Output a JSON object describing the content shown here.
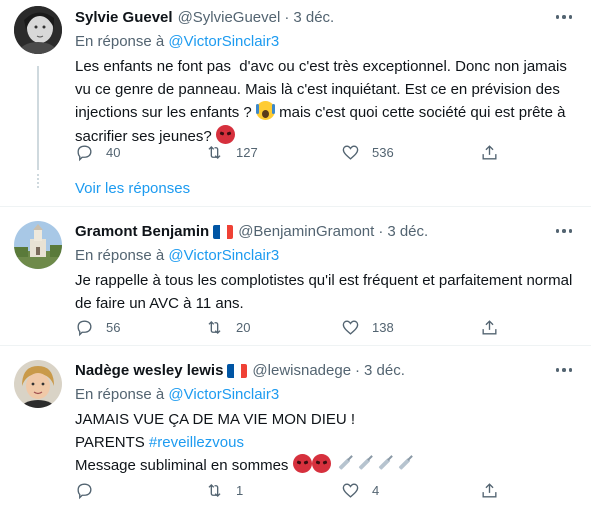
{
  "tweets": [
    {
      "name": "Sylvie Guevel",
      "handle": "@SylvieGuevel",
      "dot": "·",
      "date": "3 déc.",
      "reply_prefix": "En réponse à ",
      "reply_to": "@VictorSinclair3",
      "text_lines": [
        "Les enfants ne font pas  d'avc ou c'est très exceptionnel. Donc non jamais",
        "vu ce genre de panneau. Mais là c'est inquiétant. Est ce en prévision des",
        "injections sur les enfants ? ",
        " mais c'est quoi cette société qui est prête à",
        "sacrifier ses jeunes? "
      ],
      "replies": "40",
      "retweets": "127",
      "likes": "536",
      "avatar": "woman-portrait-grayscale"
    },
    {
      "name": "Gramont Benjamin",
      "handle": "@BenjaminGramont",
      "dot": "·",
      "date": "3 déc.",
      "flag": "france-flag",
      "reply_prefix": "En réponse à ",
      "reply_to": "@VictorSinclair3",
      "text_lines": [
        "Je rappelle à tous les complotistes qu'il est fréquent et parfaitement normal",
        "de faire un AVC à 11 ans."
      ],
      "replies": "56",
      "retweets": "20",
      "likes": "138",
      "avatar": "village-church-photo"
    },
    {
      "name": "Nadège wesley lewis",
      "handle": "@lewisnadege",
      "dot": "·",
      "date": "3 déc.",
      "flag": "france-flag",
      "reply_prefix": "En réponse à ",
      "reply_to": "@VictorSinclair3",
      "text_line1": "JAMAIS VUE ÇA DE MA VIE MON DIEU !",
      "text_line2_prefix": "PARENTS ",
      "hashtag": "#reveillezvous",
      "text_line3": "Message subliminal en sommes ",
      "replies": "",
      "retweets": "1",
      "likes": "4",
      "avatar": "woman-portrait-color"
    }
  ],
  "show_replies": "Voir les réponses",
  "colors": {
    "link": "#1d9bf0",
    "secondary": "#536471",
    "divider": "#eff3f4",
    "thread": "#cfd9de"
  },
  "icons": [
    "reply-icon",
    "retweet-icon",
    "like-icon",
    "share-icon",
    "more-icon",
    "angry-face-emoji",
    "screaming-face-emoji",
    "syringe-emoji"
  ]
}
